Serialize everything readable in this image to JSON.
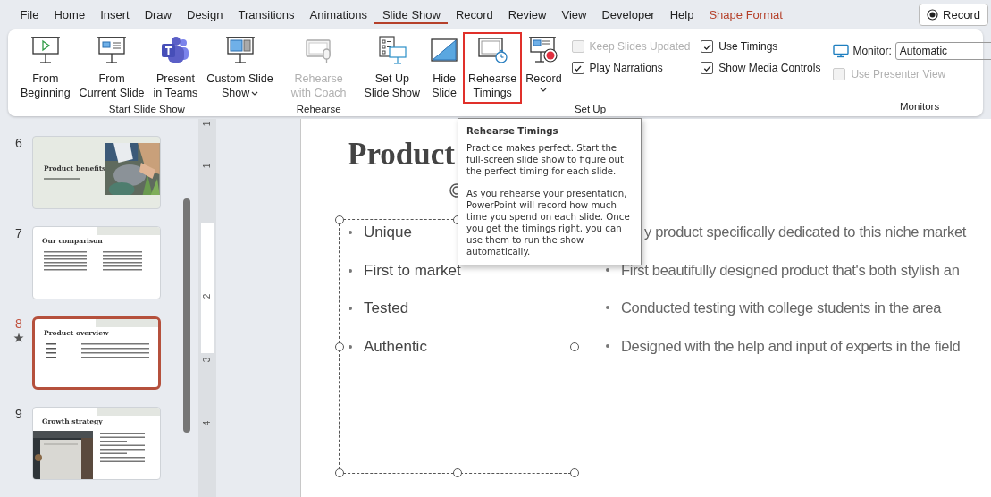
{
  "tabs": [
    {
      "label": "File",
      "selected": false,
      "kind": "normal"
    },
    {
      "label": "Home",
      "selected": false,
      "kind": "normal"
    },
    {
      "label": "Insert",
      "selected": false,
      "kind": "normal"
    },
    {
      "label": "Draw",
      "selected": false,
      "kind": "normal"
    },
    {
      "label": "Design",
      "selected": false,
      "kind": "normal"
    },
    {
      "label": "Transitions",
      "selected": false,
      "kind": "normal"
    },
    {
      "label": "Animations",
      "selected": false,
      "kind": "normal"
    },
    {
      "label": "Slide Show",
      "selected": true,
      "kind": "normal"
    },
    {
      "label": "Record",
      "selected": false,
      "kind": "normal"
    },
    {
      "label": "Review",
      "selected": false,
      "kind": "normal"
    },
    {
      "label": "View",
      "selected": false,
      "kind": "normal"
    },
    {
      "label": "Developer",
      "selected": false,
      "kind": "normal"
    },
    {
      "label": "Help",
      "selected": false,
      "kind": "normal"
    },
    {
      "label": "Shape Format",
      "selected": false,
      "kind": "contextual"
    }
  ],
  "record_button": {
    "label": "Record"
  },
  "ribbon": {
    "groups": [
      {
        "label": "Start Slide Show",
        "buttons": [
          {
            "lines": [
              "From",
              "Beginning"
            ],
            "disabled": false,
            "dropdown": false,
            "highlighted": false
          },
          {
            "lines": [
              "From",
              "Current Slide"
            ],
            "disabled": false,
            "dropdown": false,
            "highlighted": false
          },
          {
            "lines": [
              "Present",
              "in Teams"
            ],
            "disabled": false,
            "dropdown": false,
            "highlighted": false
          },
          {
            "lines": [
              "Custom Slide",
              "Show"
            ],
            "disabled": false,
            "dropdown": true,
            "highlighted": false
          }
        ]
      },
      {
        "label": "Rehearse",
        "buttons": [
          {
            "lines": [
              "Rehearse",
              "with Coach"
            ],
            "disabled": true,
            "dropdown": false,
            "highlighted": false
          }
        ]
      },
      {
        "label": "Set Up",
        "buttons": [
          {
            "lines": [
              "Set Up",
              "Slide Show"
            ],
            "disabled": false,
            "dropdown": false,
            "highlighted": false
          },
          {
            "lines": [
              "Hide",
              "Slide"
            ],
            "disabled": false,
            "dropdown": false,
            "highlighted": false
          },
          {
            "lines": [
              "Rehearse",
              "Timings"
            ],
            "disabled": false,
            "dropdown": false,
            "highlighted": true
          },
          {
            "lines": [
              "Record"
            ],
            "disabled": false,
            "dropdown": true,
            "highlighted": false
          }
        ],
        "options": [
          {
            "label": "Keep Slides Updated",
            "checked": false,
            "disabled": true
          },
          {
            "label": "Use Timings",
            "checked": true,
            "disabled": false
          },
          {
            "label": "Play Narrations",
            "checked": true,
            "disabled": false
          },
          {
            "label": "Show Media Controls",
            "checked": true,
            "disabled": false
          }
        ]
      },
      {
        "label": "Monitors",
        "monitor": {
          "label": "Monitor:",
          "value": "Automatic"
        },
        "presenter_view": {
          "label": "Use Presenter View",
          "checked": false,
          "disabled": true
        }
      }
    ]
  },
  "slides": [
    {
      "number": "6",
      "title": "Product benefits",
      "kind": "photo-right",
      "selected": false
    },
    {
      "number": "7",
      "title": "Our comparison",
      "kind": "two-column",
      "selected": false
    },
    {
      "number": "8",
      "title": "Product overview",
      "kind": "list",
      "selected": true,
      "animated": true
    },
    {
      "number": "9",
      "title": "Growth strategy",
      "kind": "photo-left",
      "selected": false
    }
  ],
  "ruler": [
    "1",
    "1",
    "2",
    "3",
    "4"
  ],
  "slide": {
    "title": "Product",
    "left_bullets": [
      "Unique",
      "First to market",
      "Tested",
      "Authentic"
    ],
    "right_bullets": [
      {
        "text": "y product specifically dedicated to this niche market",
        "bullet": false
      },
      {
        "text": "First beautifully designed product that's both stylish an",
        "bullet": true
      },
      {
        "text": "Conducted testing with college students in the area",
        "bullet": true
      },
      {
        "text": "Designed with the help and input of experts in the field",
        "bullet": true
      }
    ]
  },
  "tooltip": {
    "title": "Rehearse Timings",
    "paragraphs": [
      "Practice makes perfect. Start the full-screen slide show to figure out the perfect timing for each slide.",
      "As you rehearse your presentation, PowerPoint will record how much time you spend on each slide. Once you get the timings right, you can use them to run the show automatically."
    ]
  }
}
